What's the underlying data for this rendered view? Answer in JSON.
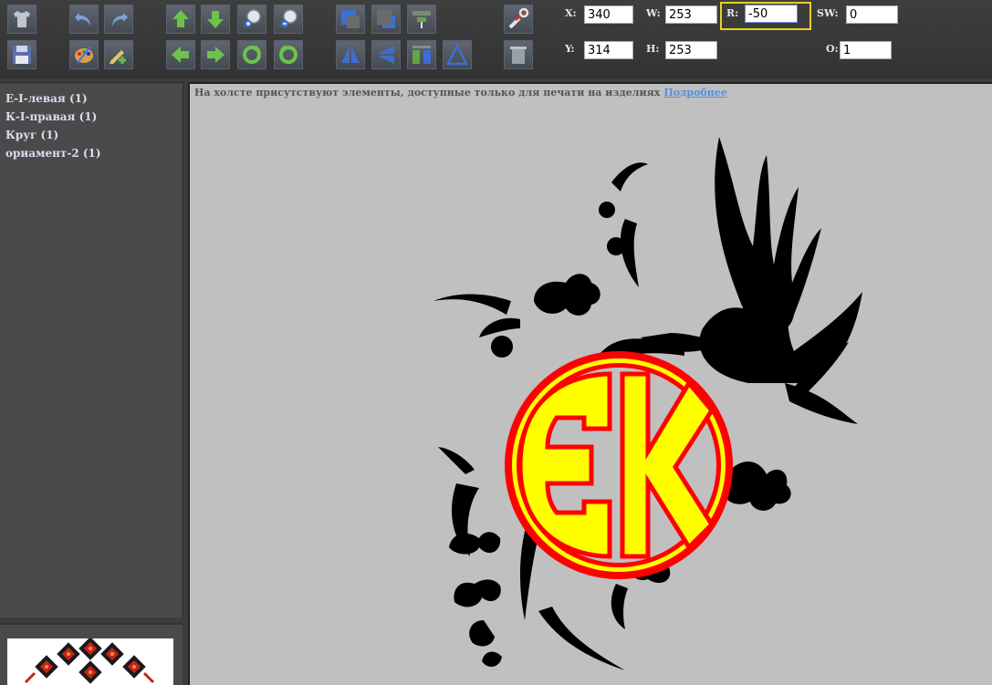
{
  "fields": {
    "x": {
      "label": "X:",
      "value": "340"
    },
    "y": {
      "label": "Y:",
      "value": "314"
    },
    "w": {
      "label": "W:",
      "value": "253"
    },
    "h": {
      "label": "H:",
      "value": "253"
    },
    "r": {
      "label": "R:",
      "value": "-50"
    },
    "sw": {
      "label": "SW:",
      "value": "0"
    },
    "o": {
      "label": "O:",
      "value": "1"
    }
  },
  "layers": [
    "Е-І-левая (1)",
    "К-І-правая (1)",
    "Круг (1)",
    "ориамент-2 (1)"
  ],
  "notice": {
    "text": "На холсте присутствуют элементы, доступные только для печати на изделиях",
    "link": "Подробнее"
  },
  "monogram": {
    "letters": "ЄК",
    "ring_color": "#ff0000",
    "fill_color": "#ffff00"
  },
  "colors": {
    "toolbar": "#3c3c3c",
    "canvas": "#c0c0c0",
    "highlight": "#e6d21e"
  }
}
